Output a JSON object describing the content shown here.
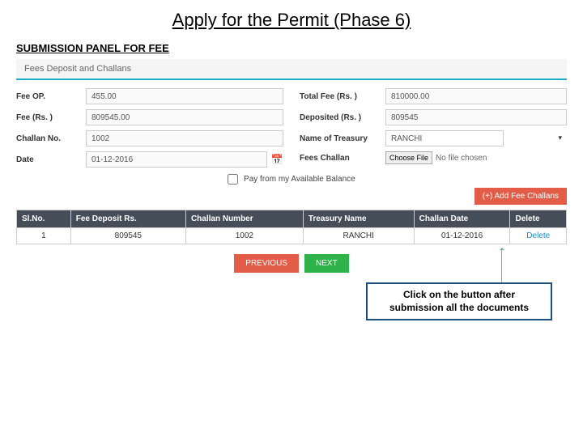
{
  "title": "Apply for the Permit (Phase 6)",
  "section": "SUBMISSION PANEL FOR FEE",
  "panel_header": "Fees Deposit and Challans",
  "left": {
    "fee_op_label": "Fee OP.",
    "fee_op_value": "455.00",
    "fee_rs_label": "Fee (Rs. )",
    "fee_rs_value": "809545.00",
    "challan_no_label": "Challan No.",
    "challan_no_value": "1002",
    "date_label": "Date",
    "date_value": "01-12-2016"
  },
  "right": {
    "total_fee_label": "Total Fee (Rs. )",
    "total_fee_value": "810000.00",
    "deposited_label": "Deposited (Rs. )",
    "deposited_value": "809545",
    "treasury_label": "Name of Treasury",
    "treasury_value": "RANCHI",
    "fees_challan_label": "Fees Challan",
    "choose_file": "Choose File",
    "no_file": "No file chosen"
  },
  "checkbox_label": "Pay from my Available Balance",
  "add_button": "(+) Add Fee Challans",
  "table": {
    "headers": {
      "sl": "Sl.No.",
      "dep": "Fee Deposit Rs.",
      "chn": "Challan Number",
      "trs": "Treasury Name",
      "cdt": "Challan Date",
      "del": "Delete"
    },
    "row": {
      "sl": "1",
      "dep": "809545",
      "chn": "1002",
      "trs": "RANCHI",
      "cdt": "01-12-2016",
      "del": "Delete"
    }
  },
  "nav": {
    "prev": "PREVIOUS",
    "next": "NEXT"
  },
  "callout": "Click on the button after submission all the documents"
}
